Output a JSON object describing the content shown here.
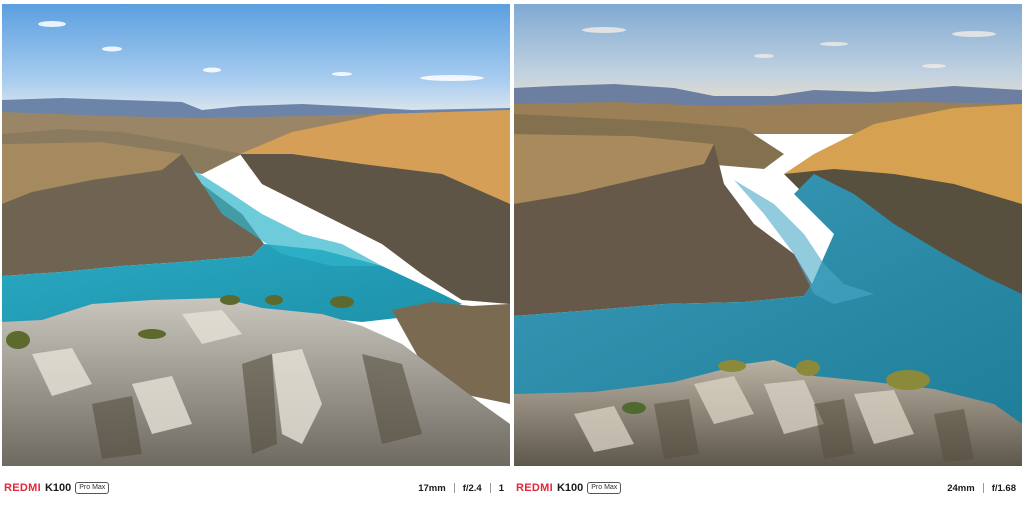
{
  "photos": [
    {
      "brand": "REDMI",
      "model": "K100",
      "badge": "Pro Max",
      "focal_length": "17mm",
      "aperture": "f/2.4",
      "extra": "1"
    },
    {
      "brand": "REDMI",
      "model": "K100",
      "badge": "Pro Max",
      "focal_length": "24mm",
      "aperture": "f/1.68"
    }
  ]
}
